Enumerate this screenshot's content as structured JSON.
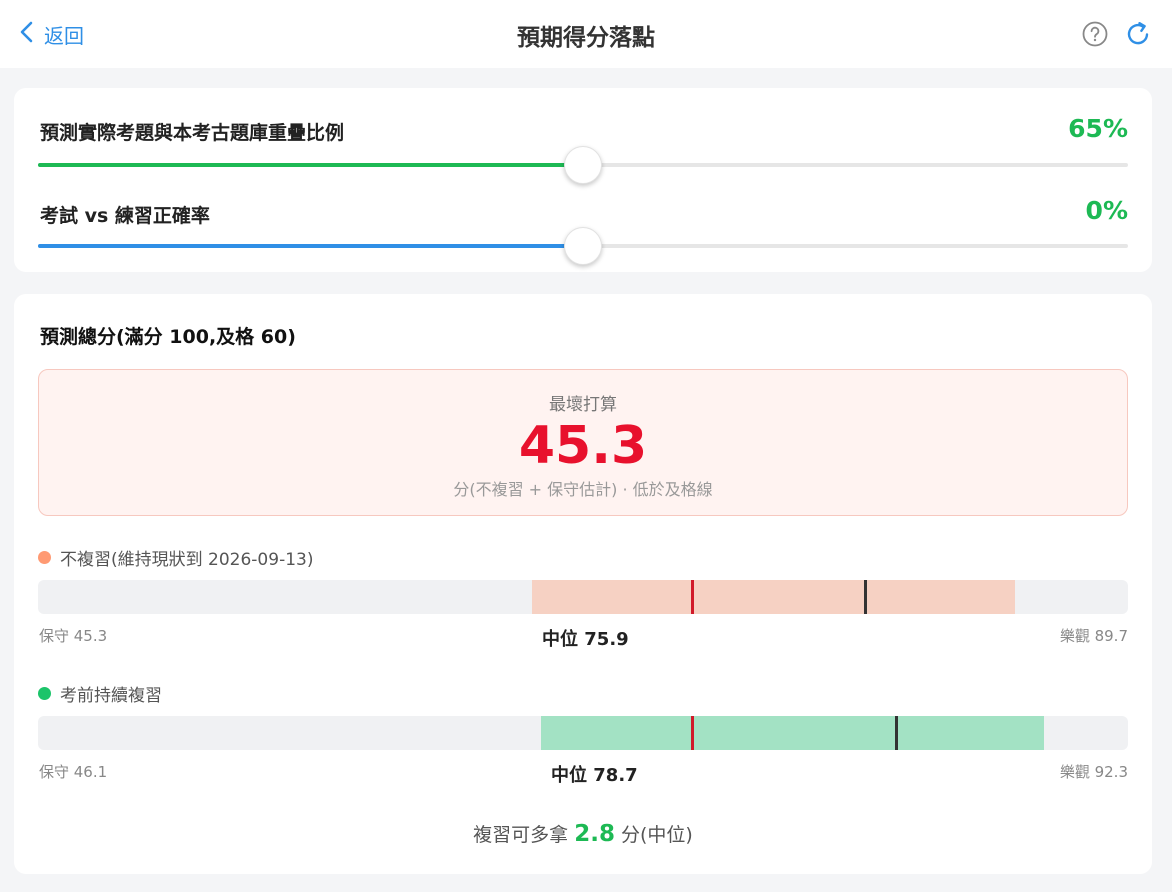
{
  "header": {
    "back_label": "返回",
    "title": "預期得分落點"
  },
  "sliders": [
    {
      "label": "預測實際考題與本考古題庫重疊比例",
      "value_text": "65%",
      "value": 0.5,
      "fill_color": "#1db954"
    },
    {
      "label": "考試 vs 練習正確率",
      "value_text": "0%",
      "value": 0.5,
      "fill_color": "#2f8fe6"
    }
  ],
  "prediction": {
    "title": "預測總分(滿分 100,及格 60)",
    "worst_case": {
      "label": "最壞打算",
      "value": "45.3",
      "note": "分(不複習 + 保守估計) · 低於及格線"
    },
    "scenarios": [
      {
        "name": "不複習(維持現狀到 2026-09-13)",
        "dot_color": "#ff9a73",
        "range_color": "#f6d1c3",
        "conservative_label": "保守 45.3",
        "median_label": "中位 75.9",
        "optimistic_label": "樂觀 89.7",
        "low": 45.3,
        "median": 75.9,
        "high": 89.7
      },
      {
        "name": "考前持續複習",
        "dot_color": "#1cc46a",
        "range_color": "#a3e2c4",
        "conservative_label": "保守 46.1",
        "median_label": "中位 78.7",
        "optimistic_label": "樂觀 92.3",
        "low": 46.1,
        "median": 78.7,
        "high": 92.3
      }
    ],
    "pass_line": 60,
    "scale_max": 100,
    "summary_prefix": "複習可多拿",
    "summary_gain": "2.8",
    "summary_suffix": "分(中位)"
  },
  "colors": {
    "accent": "#2f8fe6",
    "green": "#1db954",
    "red": "#e8112d",
    "pass_marker": "#d11a2a",
    "median_marker": "#333333"
  }
}
